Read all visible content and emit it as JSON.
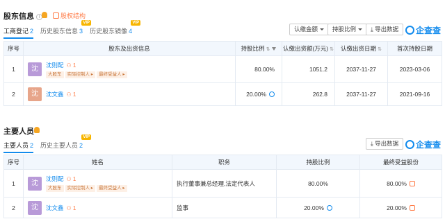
{
  "shareholders": {
    "title": "股东信息",
    "link": "股权结构",
    "tabs": [
      {
        "label": "工商登记",
        "count": "2"
      },
      {
        "label": "历史股东信息",
        "count": "3"
      },
      {
        "label": "历史股东镜像",
        "count": "4"
      }
    ],
    "vip": "VIP",
    "buttons": {
      "amount": "认缴金额",
      "ratio": "持股比例",
      "export": "导出数据"
    },
    "logo": "企查查",
    "headers": [
      "序号",
      "股东及出资信息",
      "持股比例",
      "认缴出资额(万元)",
      "认缴出资日期",
      "首次持股日期"
    ],
    "rows": [
      {
        "idx": "1",
        "avatar": "沈",
        "avatar_color": "#b89ad8",
        "name": "沈则配",
        "rel": "1",
        "tags": [
          "大股东",
          "实际控制人",
          "最终受益人"
        ],
        "ratio": "80.00%",
        "amount": "1051.2",
        "date": "2037-11-27",
        "first": "2023-03-06"
      },
      {
        "idx": "2",
        "avatar": "沈",
        "avatar_color": "#e7a58a",
        "name": "沈文鑫",
        "rel": "1",
        "tags": [],
        "ratio": "20.00%",
        "amount": "262.8",
        "date": "2037-11-27",
        "first": "2021-09-16"
      }
    ]
  },
  "personnel": {
    "title": "主要人员",
    "tabs": [
      {
        "label": "主要人员",
        "count": "2"
      },
      {
        "label": "历史主要人员",
        "count": "2"
      }
    ],
    "vip": "VIP",
    "buttons": {
      "export": "导出数据"
    },
    "logo": "企查查",
    "headers": [
      "序号",
      "姓名",
      "职务",
      "持股比例",
      "最终受益股份"
    ],
    "rows": [
      {
        "idx": "1",
        "avatar": "沈",
        "avatar_color": "#b89ad8",
        "name": "沈则配",
        "rel": "1",
        "tags": [
          "大股东",
          "实际控制人",
          "最终受益人"
        ],
        "role": "执行董事兼总经理,法定代表人",
        "ratio": "80.00%",
        "benefit": "80.00%"
      },
      {
        "idx": "2",
        "avatar": "沈",
        "avatar_color": "#b89ad8",
        "name": "沈文鑫",
        "rel": "1",
        "tags": [],
        "role": "监事",
        "ratio": "20.00%",
        "benefit": "20.00%"
      }
    ]
  }
}
